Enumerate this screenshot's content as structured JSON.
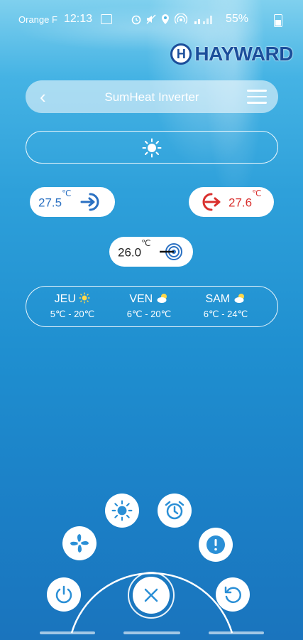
{
  "status_bar": {
    "carrier": "Orange F",
    "time": "12:13",
    "battery": "55%"
  },
  "brand": {
    "logo_letter": "H",
    "name": "HAYWARD"
  },
  "header": {
    "title": "SumHeat Inverter"
  },
  "readings": {
    "water_in": "27.5",
    "water_out": "27.6",
    "setpoint": "26.0",
    "unit": "℃"
  },
  "forecast": [
    {
      "day": "JEU",
      "range": "5℃ - 20℃",
      "icon": "sun-icon"
    },
    {
      "day": "VEN",
      "range": "6℃ - 20℃",
      "icon": "partly-cloudy-icon"
    },
    {
      "day": "SAM",
      "range": "6℃ - 24℃",
      "icon": "partly-cloudy-icon"
    }
  ],
  "colors": {
    "accent_blue": "#2a70c2",
    "accent_red": "#d9302e",
    "logo_blue": "#1b4e9b"
  }
}
